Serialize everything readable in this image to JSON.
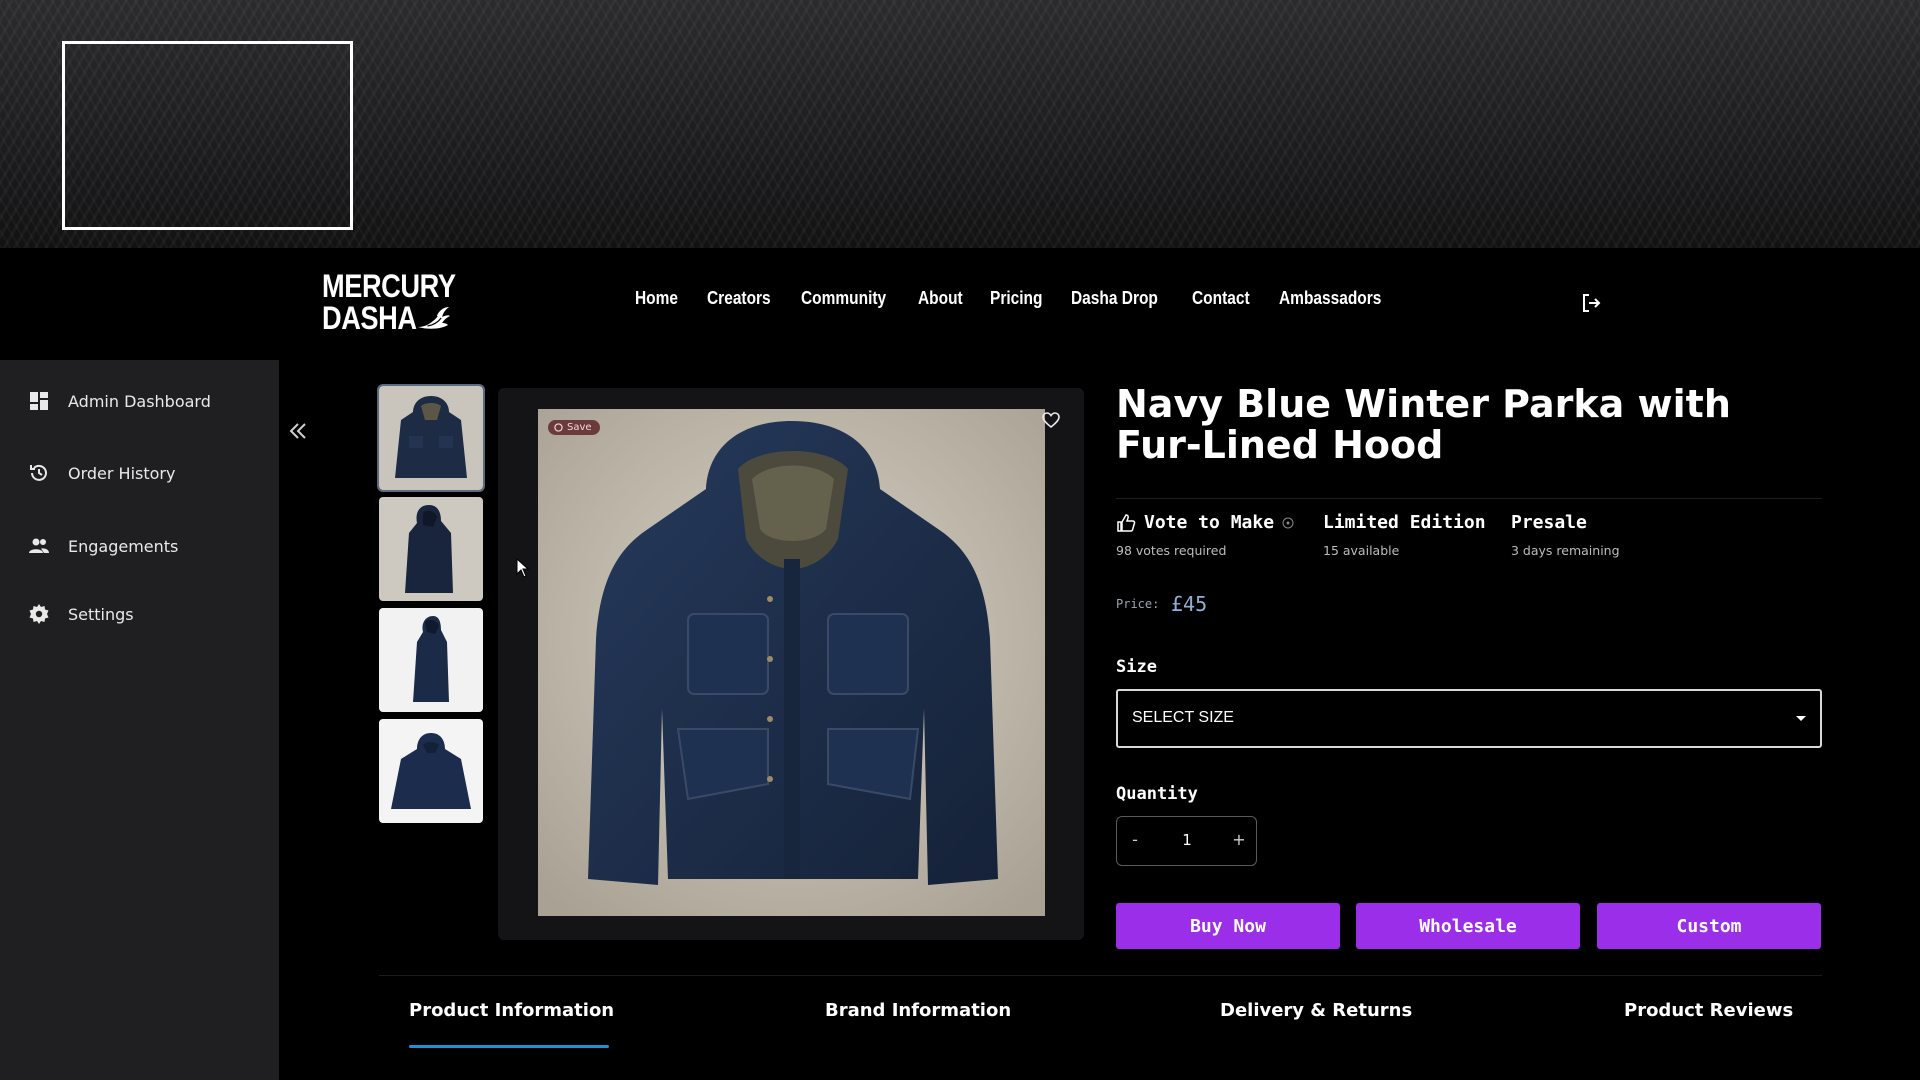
{
  "brand": {
    "logo_line1": "MERCURY",
    "logo_line2": "DASHA"
  },
  "nav": {
    "items": [
      "Home",
      "Creators",
      "Community",
      "About",
      "Pricing",
      "Dasha Drop",
      "Contact",
      "Ambassadors"
    ]
  },
  "sidebar": {
    "items": [
      {
        "label": "Admin Dashboard",
        "icon": "dashboard-icon"
      },
      {
        "label": "Order History",
        "icon": "history-icon"
      },
      {
        "label": "Engagements",
        "icon": "people-icon"
      },
      {
        "label": "Settings",
        "icon": "gear-icon"
      }
    ]
  },
  "product": {
    "save_badge": "Save",
    "title": "Navy Blue Winter Parka with Fur-Lined Hood",
    "features": [
      {
        "title": "Vote to Make",
        "sub": "98 votes required"
      },
      {
        "title": "Limited Edition",
        "sub": "15 available"
      },
      {
        "title": "Presale",
        "sub": "3 days remaining"
      }
    ],
    "price_label": "Price:",
    "price": "£45",
    "size_label": "Size",
    "size_value": "SELECT SIZE",
    "quantity_label": "Quantity",
    "quantity": "1",
    "qty_minus": "-",
    "qty_plus": "+",
    "buttons": [
      "Buy Now",
      "Wholesale",
      "Custom"
    ]
  },
  "tabs": [
    "Product Information",
    "Brand Information",
    "Delivery & Returns",
    "Product Reviews"
  ],
  "colors": {
    "accent_purple": "#9b2ee8",
    "tab_underline": "#1f8fd6",
    "price_blue": "#8fb0d6",
    "sidebar_bg": "#1f1f21"
  }
}
